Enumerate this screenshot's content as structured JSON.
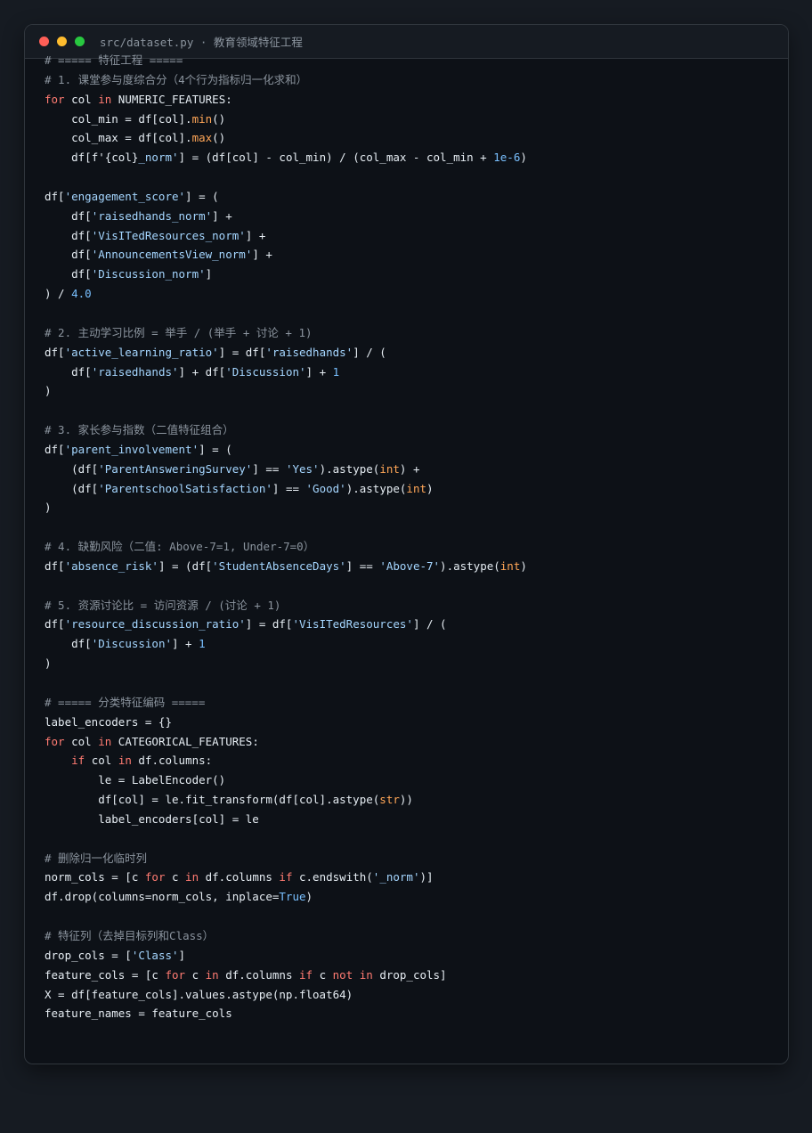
{
  "window": {
    "title": "src/dataset.py · 教育领域特征工程"
  },
  "colors": {
    "background": "#161b22",
    "editor_bg": "#0d1117",
    "plain": "#e6edf3",
    "keyword": "#ff7b72",
    "string": "#a5d6ff",
    "number": "#79c0ff",
    "function": "#ffa657",
    "comment": "#8b949e",
    "traffic_red": "#ff5f57",
    "traffic_yellow": "#febc2e",
    "traffic_green": "#28c840"
  },
  "code": {
    "lines": [
      [
        [
          "c",
          "# ===== 特征工程 ====="
        ]
      ],
      [
        [
          "c",
          "# 1. 课堂参与度综合分（4个行为指标归一化求和）"
        ]
      ],
      [
        [
          "k",
          "for"
        ],
        [
          "p",
          " col "
        ],
        [
          "k",
          "in"
        ],
        [
          "p",
          " NUMERIC_FEATURES:"
        ]
      ],
      [
        [
          "p",
          "    col_min = df[col]."
        ],
        [
          "f",
          "min"
        ],
        [
          "p",
          "()"
        ]
      ],
      [
        [
          "p",
          "    col_max = df[col]."
        ],
        [
          "f",
          "max"
        ],
        [
          "p",
          "()"
        ]
      ],
      [
        [
          "p",
          "    df["
        ],
        [
          "p",
          "f'{col}"
        ],
        [
          "s",
          "_norm'"
        ],
        [
          "p",
          "] = (df[col] - col_min) / (col_max - col_min + "
        ],
        [
          "n",
          "1e-6"
        ],
        [
          "p",
          ")"
        ]
      ],
      [],
      [
        [
          "p",
          "df["
        ],
        [
          "s",
          "'engagement_score'"
        ],
        [
          "p",
          "] = ("
        ]
      ],
      [
        [
          "p",
          "    df["
        ],
        [
          "s",
          "'raisedhands_norm'"
        ],
        [
          "p",
          "] +"
        ]
      ],
      [
        [
          "p",
          "    df["
        ],
        [
          "s",
          "'VisITedResources_norm'"
        ],
        [
          "p",
          "] +"
        ]
      ],
      [
        [
          "p",
          "    df["
        ],
        [
          "s",
          "'AnnouncementsView_norm'"
        ],
        [
          "p",
          "] +"
        ]
      ],
      [
        [
          "p",
          "    df["
        ],
        [
          "s",
          "'Discussion_norm'"
        ],
        [
          "p",
          "]"
        ]
      ],
      [
        [
          "p",
          ") / "
        ],
        [
          "n",
          "4.0"
        ]
      ],
      [],
      [
        [
          "c",
          "# 2. 主动学习比例 = 举手 / (举手 + 讨论 + 1)"
        ]
      ],
      [
        [
          "p",
          "df["
        ],
        [
          "s",
          "'active_learning_ratio'"
        ],
        [
          "p",
          "] = df["
        ],
        [
          "s",
          "'raisedhands'"
        ],
        [
          "p",
          "] / ("
        ]
      ],
      [
        [
          "p",
          "    df["
        ],
        [
          "s",
          "'raisedhands'"
        ],
        [
          "p",
          "] + df["
        ],
        [
          "s",
          "'Discussion'"
        ],
        [
          "p",
          "] + "
        ],
        [
          "n",
          "1"
        ]
      ],
      [
        [
          "p",
          ")"
        ]
      ],
      [],
      [
        [
          "c",
          "# 3. 家长参与指数（二值特征组合）"
        ]
      ],
      [
        [
          "p",
          "df["
        ],
        [
          "s",
          "'parent_involvement'"
        ],
        [
          "p",
          "] = ("
        ]
      ],
      [
        [
          "p",
          "    (df["
        ],
        [
          "s",
          "'ParentAnsweringSurvey'"
        ],
        [
          "p",
          "] == "
        ],
        [
          "s",
          "'Yes'"
        ],
        [
          "p",
          ").astype("
        ],
        [
          "f",
          "int"
        ],
        [
          "p",
          ") +"
        ]
      ],
      [
        [
          "p",
          "    (df["
        ],
        [
          "s",
          "'ParentschoolSatisfaction'"
        ],
        [
          "p",
          "] == "
        ],
        [
          "s",
          "'Good'"
        ],
        [
          "p",
          ").astype("
        ],
        [
          "f",
          "int"
        ],
        [
          "p",
          ")"
        ]
      ],
      [
        [
          "p",
          ")"
        ]
      ],
      [],
      [
        [
          "c",
          "# 4. 缺勤风险（二值: Above-7=1, Under-7=0）"
        ]
      ],
      [
        [
          "p",
          "df["
        ],
        [
          "s",
          "'absence_risk'"
        ],
        [
          "p",
          "] = (df["
        ],
        [
          "s",
          "'StudentAbsenceDays'"
        ],
        [
          "p",
          "] == "
        ],
        [
          "s",
          "'Above-7'"
        ],
        [
          "p",
          ").astype("
        ],
        [
          "f",
          "int"
        ],
        [
          "p",
          ")"
        ]
      ],
      [],
      [
        [
          "c",
          "# 5. 资源讨论比 = 访问资源 / (讨论 + 1)"
        ]
      ],
      [
        [
          "p",
          "df["
        ],
        [
          "s",
          "'resource_discussion_ratio'"
        ],
        [
          "p",
          "] = df["
        ],
        [
          "s",
          "'VisITedResources'"
        ],
        [
          "p",
          "] / ("
        ]
      ],
      [
        [
          "p",
          "    df["
        ],
        [
          "s",
          "'Discussion'"
        ],
        [
          "p",
          "] + "
        ],
        [
          "n",
          "1"
        ]
      ],
      [
        [
          "p",
          ")"
        ]
      ],
      [],
      [
        [
          "c",
          "# ===== 分类特征编码 ====="
        ]
      ],
      [
        [
          "p",
          "label_encoders = {}"
        ]
      ],
      [
        [
          "k",
          "for"
        ],
        [
          "p",
          " col "
        ],
        [
          "k",
          "in"
        ],
        [
          "p",
          " CATEGORICAL_FEATURES:"
        ]
      ],
      [
        [
          "p",
          "    "
        ],
        [
          "k",
          "if"
        ],
        [
          "p",
          " col "
        ],
        [
          "k",
          "in"
        ],
        [
          "p",
          " df.columns:"
        ]
      ],
      [
        [
          "p",
          "        le = LabelEncoder()"
        ]
      ],
      [
        [
          "p",
          "        df[col] = le.fit_transform(df[col].astype("
        ],
        [
          "f",
          "str"
        ],
        [
          "p",
          "))"
        ]
      ],
      [
        [
          "p",
          "        label_encoders[col] = le"
        ]
      ],
      [],
      [
        [
          "c",
          "# 删除归一化临时列"
        ]
      ],
      [
        [
          "p",
          "norm_cols = [c "
        ],
        [
          "k",
          "for"
        ],
        [
          "p",
          " c "
        ],
        [
          "k",
          "in"
        ],
        [
          "p",
          " df.columns "
        ],
        [
          "k",
          "if"
        ],
        [
          "p",
          " c.endswith("
        ],
        [
          "s",
          "'_norm'"
        ],
        [
          "p",
          ")]"
        ]
      ],
      [
        [
          "p",
          "df.drop(columns=norm_cols, inplace="
        ],
        [
          "n",
          "True"
        ],
        [
          "p",
          ")"
        ]
      ],
      [],
      [
        [
          "c",
          "# 特征列（去掉目标列和Class）"
        ]
      ],
      [
        [
          "p",
          "drop_cols = ["
        ],
        [
          "s",
          "'Class'"
        ],
        [
          "p",
          "]"
        ]
      ],
      [
        [
          "p",
          "feature_cols = [c "
        ],
        [
          "k",
          "for"
        ],
        [
          "p",
          " c "
        ],
        [
          "k",
          "in"
        ],
        [
          "p",
          " df.columns "
        ],
        [
          "k",
          "if"
        ],
        [
          "p",
          " c "
        ],
        [
          "k",
          "not in"
        ],
        [
          "p",
          " drop_cols]"
        ]
      ],
      [
        [
          "p",
          "X = df[feature_cols].values.astype(np.float64)"
        ]
      ],
      [
        [
          "p",
          "feature_names = feature_cols"
        ]
      ]
    ]
  }
}
